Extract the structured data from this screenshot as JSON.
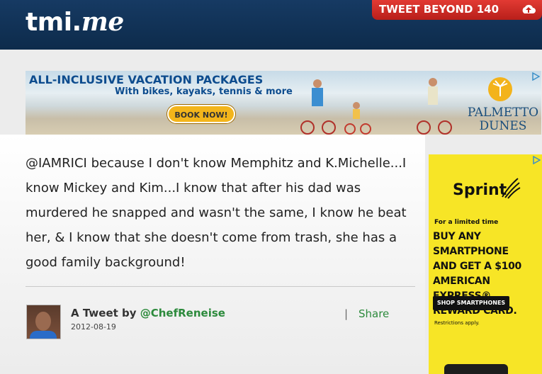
{
  "header": {
    "logo_main": "tmi.",
    "logo_suffix": "me",
    "tweet_button": "TWEET BEYOND 140"
  },
  "banner_ad": {
    "headline": "ALL-INCLUSIVE VACATION PACKAGES",
    "subline": "With bikes, kayaks, tennis & more",
    "cta": "BOOK NOW!",
    "brand_line1": "PALMETTO",
    "brand_line2": "DUNES"
  },
  "tweet": {
    "text": "@IAMRICI because I don't know Memphitz and K.Michelle...I know Mickey and Kim...I know that after his dad was murdered he snapped and wasn't the same, I know he beat her, & I know that she doesn't come from trash, she has a good family background!",
    "byline_prefix": "A Tweet by ",
    "author_handle": "@ChefReneise",
    "date": "2012-08-19",
    "separator": "|",
    "share_label": "Share"
  },
  "side_ad": {
    "brand": "Sprint",
    "limited": "For a limited time",
    "offer_lines": [
      "BUY ANY SMARTPHONE",
      "AND GET A $100",
      "AMERICAN EXPRESS®",
      "REWARD CARD."
    ],
    "cta": "SHOP SMARTPHONES",
    "restrictions": "Restrictions apply."
  },
  "colors": {
    "header_bg": "#163a63",
    "tweet_button": "#d42f29",
    "link_green": "#2c8a3c",
    "sidebar_ad_bg": "#f7e526"
  }
}
